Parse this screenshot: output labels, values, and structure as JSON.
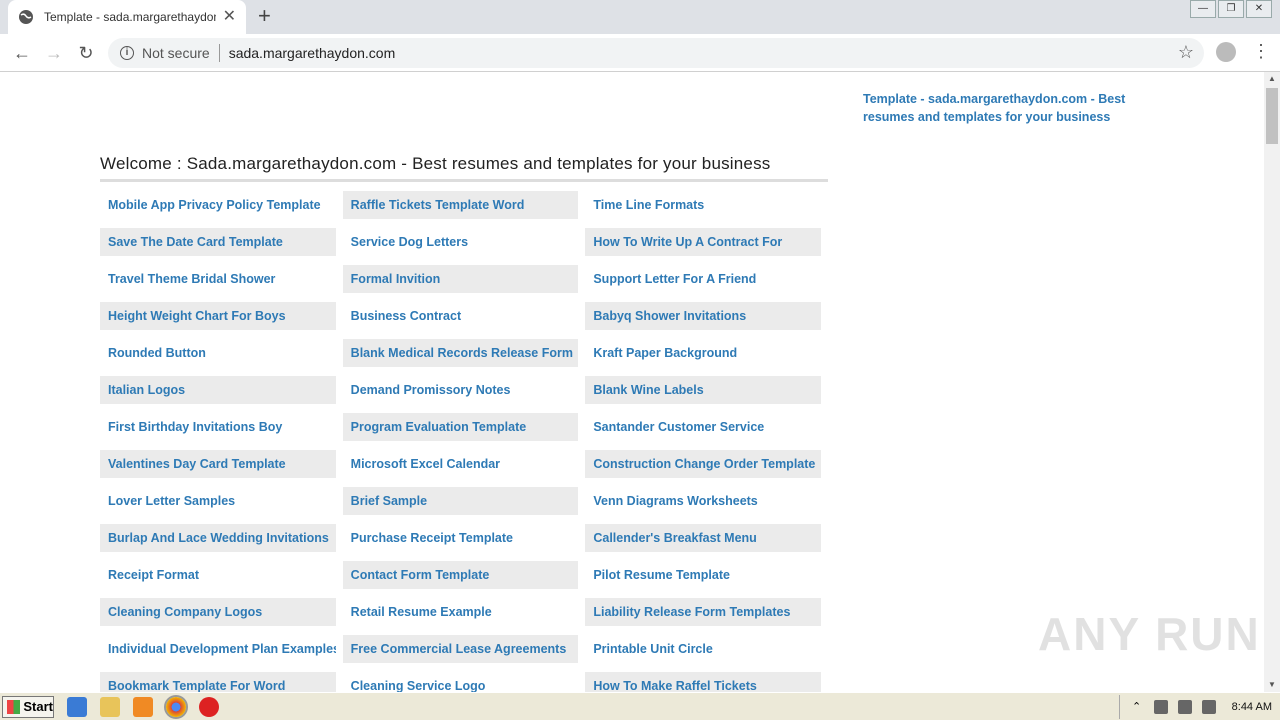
{
  "browser": {
    "tab_title": "Template - sada.margarethaydon.com",
    "security_label": "Not secure",
    "url": "sada.margarethaydon.com"
  },
  "page": {
    "side_link": "Template - sada.margarethaydon.com - Best resumes and templates for your business",
    "welcome": "Welcome : Sada.margarethaydon.com - Best resumes and templates for your business",
    "rows": [
      [
        "Mobile App Privacy Policy Template",
        "Raffle Tickets Template Word",
        "Time Line Formats"
      ],
      [
        "Save The Date Card Template",
        "Service Dog Letters",
        "How To Write Up A Contract For"
      ],
      [
        "Travel Theme Bridal Shower",
        "Formal Invition",
        "Support Letter For A Friend"
      ],
      [
        "Height Weight Chart For Boys",
        "Business Contract",
        "Babyq Shower Invitations"
      ],
      [
        "Rounded Button",
        "Blank Medical Records Release Form",
        "Kraft Paper Background"
      ],
      [
        "Italian Logos",
        "Demand Promissory Notes",
        "Blank Wine Labels"
      ],
      [
        "First Birthday Invitations Boy",
        "Program Evaluation Template",
        "Santander Customer Service"
      ],
      [
        "Valentines Day Card Template",
        "Microsoft Excel Calendar",
        "Construction Change Order Template"
      ],
      [
        "Lover Letter Samples",
        "Brief Sample",
        "Venn Diagrams Worksheets"
      ],
      [
        "Burlap And Lace Wedding Invitations",
        "Purchase Receipt Template",
        "Callender's Breakfast Menu"
      ],
      [
        "Receipt Format",
        "Contact Form Template",
        "Pilot Resume Template"
      ],
      [
        "Cleaning Company Logos",
        "Retail Resume Example",
        "Liability Release Form Templates"
      ],
      [
        "Individual Development Plan Examples",
        "Free Commercial Lease Agreements",
        "Printable Unit Circle"
      ],
      [
        "Bookmark Template For Word",
        "Cleaning Service Logo",
        "How To Make Raffel Tickets"
      ]
    ],
    "watermark": "ANY RUN"
  },
  "taskbar": {
    "start_label": "Start",
    "clock": "8:44 AM"
  },
  "colors": {
    "link": "#2e7ab5",
    "cell_shade": "#ebebeb"
  }
}
